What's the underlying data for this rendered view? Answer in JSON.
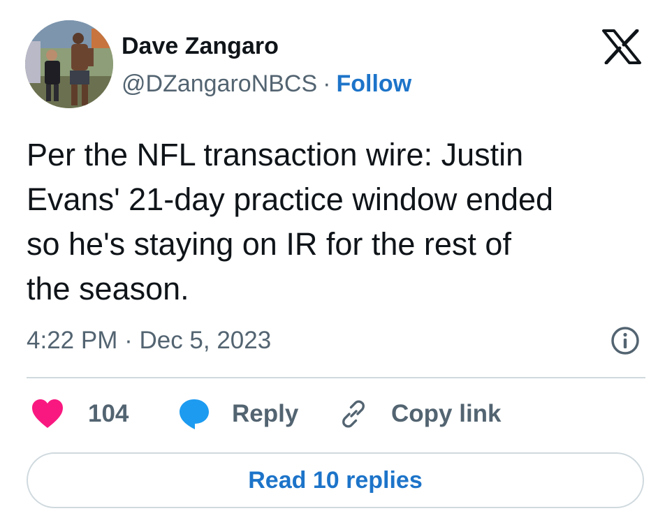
{
  "author": {
    "name": "Dave Zangaro",
    "handle": "@DZangaroNBCS",
    "separator": "·",
    "follow_label": "Follow",
    "avatar_icon": "profile-photo"
  },
  "platform_logo": "x-logo-icon",
  "tweet": {
    "text": "Per the NFL transaction wire: Justin\nEvans' 21-day practice window ended\nso he's staying on IR for the rest of\nthe season.",
    "timestamp": "4:22 PM · Dec 5, 2023"
  },
  "info_icon": "info-icon",
  "actions": {
    "like_count": "104",
    "reply_label": "Reply",
    "copy_link_label": "Copy link"
  },
  "read_replies_label": "Read 10 replies",
  "colors": {
    "accent": "#1d74c9",
    "like": "#f91880",
    "reply_icon": "#1d9bf0",
    "secondary_text": "#536471",
    "border": "#cfd9de"
  }
}
